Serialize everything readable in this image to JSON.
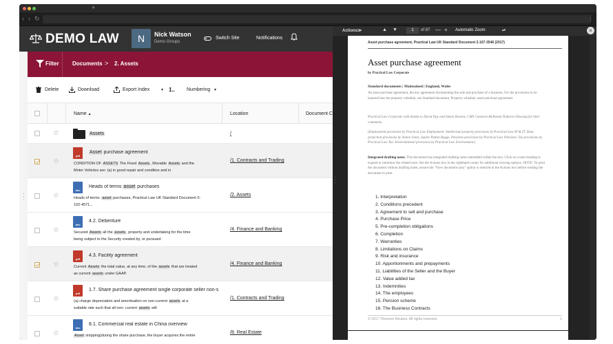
{
  "browser": {
    "newtab": "+"
  },
  "app": {
    "logo": "DEMO LAW",
    "user": {
      "initial": "N",
      "name": "Nick Watson",
      "group": "Demo Groups"
    },
    "switch_site": "Switch Site",
    "notifications": "Notifications"
  },
  "crumbs": {
    "filter": "Filter",
    "documents": "Documents",
    "sep": ">",
    "current": "2. Assets"
  },
  "toolbar": {
    "delete": "Delete",
    "download": "Download",
    "export": "Export Index",
    "numbering_num": "1..",
    "numbering": "Numbering"
  },
  "table": {
    "headers": {
      "name": "Name",
      "sort": "▲",
      "location": "Location",
      "document": "Document C"
    },
    "rows": [
      {
        "title": "Assets",
        "location": "/"
      },
      {
        "title_hl": "Asset",
        "title_rest": " purchase agreement",
        "badge": "pdf",
        "s1a": "CONDITION OF ",
        "s1h": "ASSETS",
        "s1b": " The Fixed ",
        "s1h2": "Assets",
        "s1c": ", Movable ",
        "s1h3": "Assets",
        "s1d": " and the",
        "s2": "Motor Vehicles are: (a) in good repair and condition and in",
        "location": "/1. Contracts and Trading"
      },
      {
        "title_pre": "Heads of terms ",
        "title_hl": "asset",
        "title_rest": " purchases",
        "badge": "doc",
        "s1a": "Heads of terms: ",
        "s1h": "asset",
        "s1b": " purchases, Practical Law UK Standard Document 0-",
        "s2": "102-4571...",
        "location": "/2. Assets"
      },
      {
        "title": "4.2. Debenture",
        "badge": "doc",
        "s1a": "Secured ",
        "s1h": "Assets",
        "s1b": " all the ",
        "s1h2": "assets",
        "s1c": ", property and undertaking for the time",
        "s2": "being subject to the Security created by, or pursuant",
        "location": "/4. Finance and Banking"
      },
      {
        "title": "4.3. Facility agreement",
        "badge": "pdf",
        "s1a": "Current ",
        "s1h": "Assets",
        "s1b": " the total value, at any time, of the ",
        "s1h2": "assets",
        "s1c": " that are treated",
        "s2a": "as current ",
        "s2h": "assets",
        "s2b": " under GAAP.",
        "location": "/4. Finance and Banking"
      },
      {
        "title": "1.7. Share purchase agreement single corporate seller non-s",
        "badge": "pdf",
        "s1": "(a) charge depreciation and amortisation on non-current ",
        "s1h": "assets",
        "s1c": " at a",
        "s2": "suitable rate such that all non- current ",
        "s2h": "assets",
        "s2b": " will",
        "location": "/1. Contracts and Trading"
      },
      {
        "title": "8.1. Commercial real estate in China overview",
        "badge": "doc",
        "s1h": "Asset",
        "s1b": " stripping(during the share purchase, the buyer acquires the entire",
        "location": "/8. Real Estate"
      }
    ]
  },
  "viewer": {
    "actions": "Actions",
    "page": "1",
    "of": "of 87",
    "minus": "—",
    "plus": "+",
    "zoom": "Automatic Zoom",
    "close": "×",
    "doc_header": "Asset purchase agreement, Practical Law UK Standard Document 2-107-3546 (2017)",
    "title": "Asset purchase agreement",
    "by": "by Practical Law Corporate",
    "standard": "Standard documents | Maintained | England, Wales",
    "p1": "An asset purchase agreement, the key agreement documenting the sale and purchase of a business. For the provisions to be inserted into the property schedule, see Standard document, Property schedule: asset purchase agreement.",
    "p2": "Practical Law Corporate with thanks to David Day and Simon Howley, CMS Cameron McKenna Nabarro Olswang for their comments.",
    "p3": "(Employment provisions by Practical Law Employment. Intellectual property provisions by Practical Law IP & IT. Data protection provisions by Simon Jones, Squire Patton Boggs. Pensions provisions by Practical Law Pensions. Tax provisions by Practical Law Tax. Environmental provisions by Practical Law Environment.)",
    "p4_bold": "Integrated drafting notes.",
    "p4": " This document has integrated drafting notes embedded within the text. Click on a note heading to expand or minimise the related note. See the Actions box in the righthand corner for additional viewing options. NOTE: To print the document without drafting notes, ensure the \"View document only\" option is selected in the Actions box before sending the document to print.",
    "contents": [
      "1. Interpretation",
      "2. Conditions precedent",
      "3. Agreement to sell and purchase",
      "4. Purchase Price",
      "5. Pre-completion obligations",
      "6. Completion",
      "7. Warranties",
      "8. Limitations on Claims",
      "9. Risk and insurance",
      "10. Apportionments and prepayments",
      "11. Liabilities of the Seller and the Buyer",
      "12. Value added tax",
      "13. Indemnities",
      "14. The employees",
      "15. Pension scheme",
      "16. The Business Contracts"
    ],
    "footer": "© 2017 Thomson Reuters. All rights reserved.",
    "footer_page": "1"
  }
}
